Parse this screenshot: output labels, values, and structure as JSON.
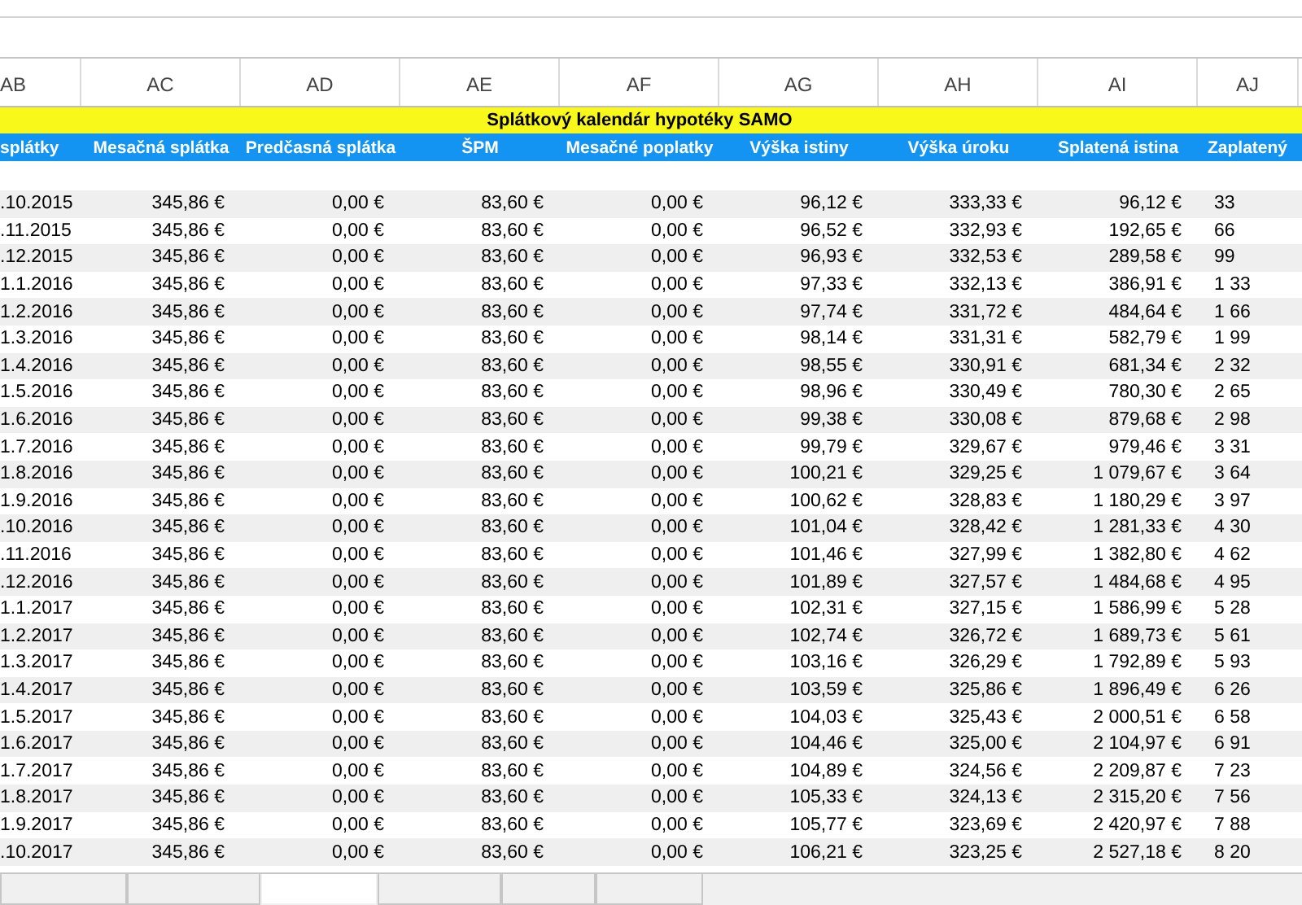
{
  "column_letters": [
    "AB",
    "AC",
    "AD",
    "AE",
    "AF",
    "AG",
    "AH",
    "AI",
    "AJ"
  ],
  "title": "Splátkový kalendár hypotéky SAMO",
  "sheet_tabs": [
    {
      "selected": false
    },
    {
      "selected": false
    },
    {
      "selected": true
    },
    {
      "selected": false
    },
    {
      "selected": false
    },
    {
      "selected": false
    }
  ],
  "columns": [
    "splátky",
    "Mesačná splátka",
    "Predčasná splátka",
    "ŠPM",
    "Mesačné poplatky",
    "Výška istiny",
    "Výška úroku",
    "Splatená istina",
    "Zaplatený"
  ],
  "rows": [
    [
      ".10.2015",
      "345,86 €",
      "0,00 €",
      "83,60 €",
      "0,00 €",
      "96,12 €",
      "333,33 €",
      "96,12 €",
      "33"
    ],
    [
      ".11.2015",
      "345,86 €",
      "0,00 €",
      "83,60 €",
      "0,00 €",
      "96,52 €",
      "332,93 €",
      "192,65 €",
      "66"
    ],
    [
      ".12.2015",
      "345,86 €",
      "0,00 €",
      "83,60 €",
      "0,00 €",
      "96,93 €",
      "332,53 €",
      "289,58 €",
      "99"
    ],
    [
      "1.1.2016",
      "345,86 €",
      "0,00 €",
      "83,60 €",
      "0,00 €",
      "97,33 €",
      "332,13 €",
      "386,91 €",
      "1 33"
    ],
    [
      "1.2.2016",
      "345,86 €",
      "0,00 €",
      "83,60 €",
      "0,00 €",
      "97,74 €",
      "331,72 €",
      "484,64 €",
      "1 66"
    ],
    [
      "1.3.2016",
      "345,86 €",
      "0,00 €",
      "83,60 €",
      "0,00 €",
      "98,14 €",
      "331,31 €",
      "582,79 €",
      "1 99"
    ],
    [
      "1.4.2016",
      "345,86 €",
      "0,00 €",
      "83,60 €",
      "0,00 €",
      "98,55 €",
      "330,91 €",
      "681,34 €",
      "2 32"
    ],
    [
      "1.5.2016",
      "345,86 €",
      "0,00 €",
      "83,60 €",
      "0,00 €",
      "98,96 €",
      "330,49 €",
      "780,30 €",
      "2 65"
    ],
    [
      "1.6.2016",
      "345,86 €",
      "0,00 €",
      "83,60 €",
      "0,00 €",
      "99,38 €",
      "330,08 €",
      "879,68 €",
      "2 98"
    ],
    [
      "1.7.2016",
      "345,86 €",
      "0,00 €",
      "83,60 €",
      "0,00 €",
      "99,79 €",
      "329,67 €",
      "979,46 €",
      "3 31"
    ],
    [
      "1.8.2016",
      "345,86 €",
      "0,00 €",
      "83,60 €",
      "0,00 €",
      "100,21 €",
      "329,25 €",
      "1 079,67 €",
      "3 64"
    ],
    [
      "1.9.2016",
      "345,86 €",
      "0,00 €",
      "83,60 €",
      "0,00 €",
      "100,62 €",
      "328,83 €",
      "1 180,29 €",
      "3 97"
    ],
    [
      ".10.2016",
      "345,86 €",
      "0,00 €",
      "83,60 €",
      "0,00 €",
      "101,04 €",
      "328,42 €",
      "1 281,33 €",
      "4 30"
    ],
    [
      ".11.2016",
      "345,86 €",
      "0,00 €",
      "83,60 €",
      "0,00 €",
      "101,46 €",
      "327,99 €",
      "1 382,80 €",
      "4 62"
    ],
    [
      ".12.2016",
      "345,86 €",
      "0,00 €",
      "83,60 €",
      "0,00 €",
      "101,89 €",
      "327,57 €",
      "1 484,68 €",
      "4 95"
    ],
    [
      "1.1.2017",
      "345,86 €",
      "0,00 €",
      "83,60 €",
      "0,00 €",
      "102,31 €",
      "327,15 €",
      "1 586,99 €",
      "5 28"
    ],
    [
      "1.2.2017",
      "345,86 €",
      "0,00 €",
      "83,60 €",
      "0,00 €",
      "102,74 €",
      "326,72 €",
      "1 689,73 €",
      "5 61"
    ],
    [
      "1.3.2017",
      "345,86 €",
      "0,00 €",
      "83,60 €",
      "0,00 €",
      "103,16 €",
      "326,29 €",
      "1 792,89 €",
      "5 93"
    ],
    [
      "1.4.2017",
      "345,86 €",
      "0,00 €",
      "83,60 €",
      "0,00 €",
      "103,59 €",
      "325,86 €",
      "1 896,49 €",
      "6 26"
    ],
    [
      "1.5.2017",
      "345,86 €",
      "0,00 €",
      "83,60 €",
      "0,00 €",
      "104,03 €",
      "325,43 €",
      "2 000,51 €",
      "6 58"
    ],
    [
      "1.6.2017",
      "345,86 €",
      "0,00 €",
      "83,60 €",
      "0,00 €",
      "104,46 €",
      "325,00 €",
      "2 104,97 €",
      "6 91"
    ],
    [
      "1.7.2017",
      "345,86 €",
      "0,00 €",
      "83,60 €",
      "0,00 €",
      "104,89 €",
      "324,56 €",
      "2 209,87 €",
      "7 23"
    ],
    [
      "1.8.2017",
      "345,86 €",
      "0,00 €",
      "83,60 €",
      "0,00 €",
      "105,33 €",
      "324,13 €",
      "2 315,20 €",
      "7 56"
    ],
    [
      "1.9.2017",
      "345,86 €",
      "0,00 €",
      "83,60 €",
      "0,00 €",
      "105,77 €",
      "323,69 €",
      "2 420,97 €",
      "7 88"
    ],
    [
      ".10.2017",
      "345,86 €",
      "0,00 €",
      "83,60 €",
      "0,00 €",
      "106,21 €",
      "323,25 €",
      "2 527,18 €",
      "8 20"
    ]
  ]
}
